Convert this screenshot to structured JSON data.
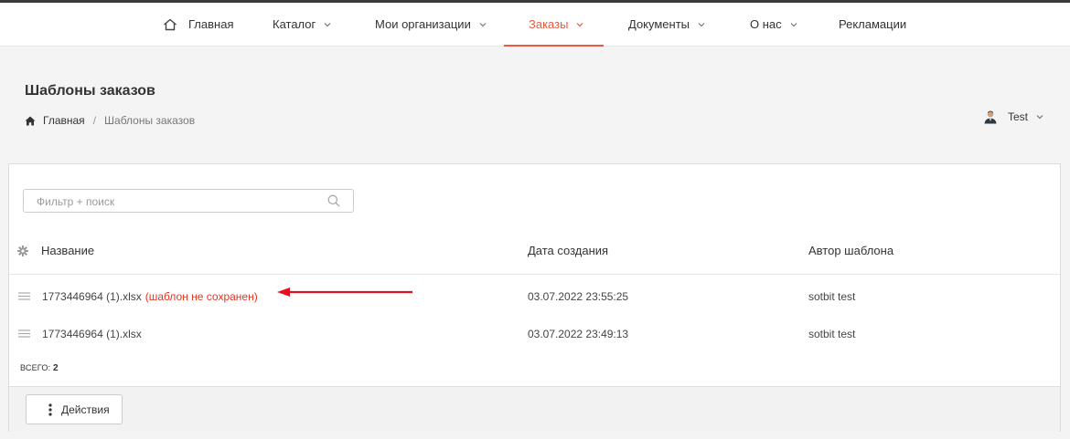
{
  "nav": {
    "items": [
      {
        "label": "Главная",
        "icon": "home-icon",
        "dropdown": false,
        "active": false
      },
      {
        "label": "Каталог",
        "dropdown": true,
        "active": false
      },
      {
        "label": "Мои организации",
        "dropdown": true,
        "active": false
      },
      {
        "label": "Заказы",
        "dropdown": true,
        "active": true
      },
      {
        "label": "Документы",
        "dropdown": true,
        "active": false
      },
      {
        "label": "О нас",
        "dropdown": true,
        "active": false
      },
      {
        "label": "Рекламации",
        "dropdown": false,
        "active": false
      }
    ],
    "accent_color": "#e85a3c"
  },
  "page": {
    "title": "Шаблоны заказов",
    "breadcrumb": {
      "home": "Главная",
      "separator": "/",
      "current": "Шаблоны заказов"
    }
  },
  "user": {
    "name": "Test",
    "icon": "user-icon"
  },
  "grid": {
    "search": {
      "placeholder": "Фильтр + поиск",
      "value": ""
    },
    "columns": [
      "Название",
      "Дата создания",
      "Автор шаблона"
    ],
    "rows": [
      {
        "name": "1773446964 (1).xlsx",
        "note": "(шаблон не сохранен)",
        "date": "03.07.2022 23:55:25",
        "author": "sotbit test"
      },
      {
        "name": "1773446964 (1).xlsx",
        "note": "",
        "date": "03.07.2022 23:49:13",
        "author": "sotbit test"
      }
    ],
    "total_label": "ВСЕГО:",
    "total_value": "2",
    "warning_color": "#e8321f"
  },
  "footer": {
    "actions_label": "Действия"
  }
}
